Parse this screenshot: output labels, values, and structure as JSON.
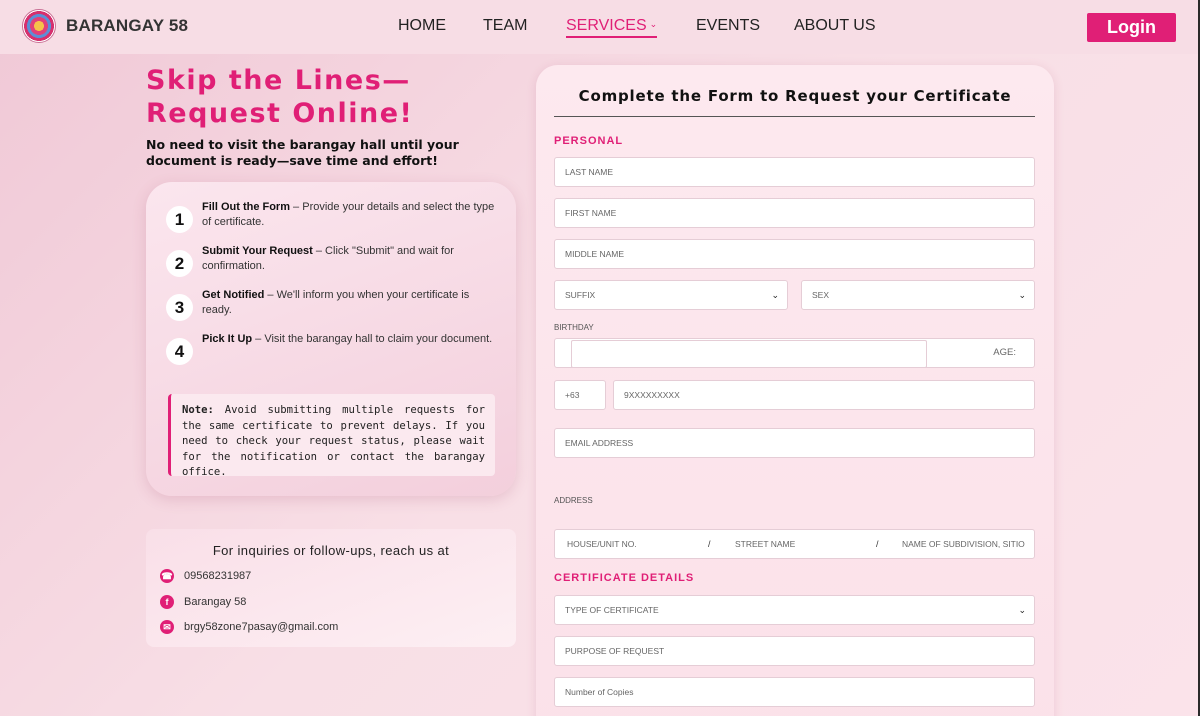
{
  "nav": {
    "brand": "BARANGAY 58",
    "items": [
      {
        "label": "HOME"
      },
      {
        "label": "TEAM"
      },
      {
        "label": "SERVICES"
      },
      {
        "label": "EVENTS"
      },
      {
        "label": "ABOUT US"
      }
    ],
    "login": "Login",
    "active": "SERVICES"
  },
  "hero": {
    "title_line1": "Skip the Lines—",
    "title_line2": "Request Online!",
    "subtitle": "No need to visit the barangay hall until your document is ready—save time and effort!"
  },
  "steps": [
    {
      "num": "1",
      "title": "Fill Out the Form",
      "desc": " – Provide your details and select the type of certificate."
    },
    {
      "num": "2",
      "title": "Submit Your Request",
      "desc": " – Click \"Submit\" and wait for confirmation."
    },
    {
      "num": "3",
      "title": "Get Notified",
      "desc": " – We'll inform you when your certificate is ready."
    },
    {
      "num": "4",
      "title": "Pick It Up",
      "desc": " – Visit the barangay hall to claim your document."
    }
  ],
  "note": {
    "label": "Note:",
    "text": " Avoid submitting multiple requests for the same certificate to prevent delays. If you need to check your request status, please wait for the notification or contact the barangay office."
  },
  "contact": {
    "title": "For inquiries or follow-ups, reach us at",
    "phone": "09568231987",
    "facebook": "Barangay 58",
    "email": "brgy58zone7pasay@gmail.com"
  },
  "form": {
    "title": "Complete the Form to Request your Certificate",
    "personal_label": "PERSONAL",
    "last_name": "LAST NAME",
    "first_name": "FIRST NAME",
    "middle_name": "MIDDLE NAME",
    "suffix": "SUFFIX",
    "sex": "SEX",
    "birthday_label": "BIRTHDAY",
    "age_label": "AGE:",
    "country_code": "+63",
    "phone_placeholder": "9XXXXXXXXX",
    "email": "EMAIL ADDRESS",
    "address_label": "ADDRESS",
    "house": "HOUSE/UNIT NO.",
    "street": "STREET NAME",
    "subdivision": "NAME OF SUBDIVISION, SITIO",
    "separator": "/",
    "cert_label": "CERTIFICATE DETAILS",
    "cert_type": "TYPE OF CERTIFICATE",
    "purpose": "PURPOSE OF REQUEST",
    "copies": "Number of Copies"
  },
  "colors": {
    "accent": "#e01f76"
  }
}
